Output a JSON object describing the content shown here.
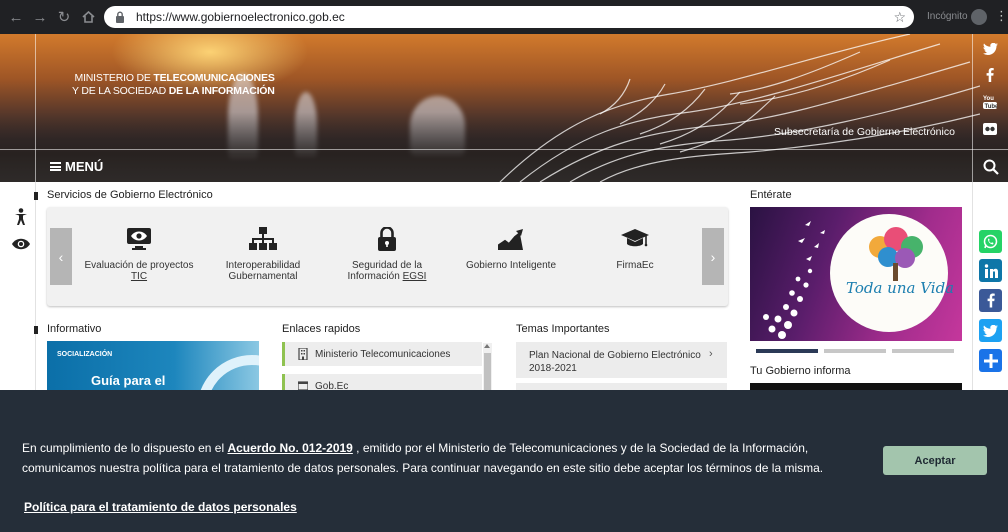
{
  "browser": {
    "url": "https://www.gobiernoelectronico.gob.ec",
    "incognito_label": "Incógnito"
  },
  "header": {
    "ministry_line1_a": "MINISTERIO DE ",
    "ministry_line1_b": "TELECOMUNICACIONES",
    "ministry_line2_a": "Y DE LA SOCIEDAD ",
    "ministry_line2_b": "DE LA INFORMACIÓN",
    "subsecretaria": "Subsecretaría de Gobierno Electrónico",
    "menu_label": "MENÚ"
  },
  "services": {
    "title": "Servicios de Gobierno Electrónico",
    "items": [
      {
        "label": "Evaluación de proyectos",
        "label2": "TIC",
        "icon": "monitor-eye-icon"
      },
      {
        "label": "Interoperabilidad",
        "label2": "Gubernamental",
        "icon": "hierarchy-icon"
      },
      {
        "label": "Seguridad de la",
        "label2a": "Información ",
        "label2b": "EGSI",
        "icon": "padlock-icon"
      },
      {
        "label": "Gobierno Inteligente",
        "icon": "growth-chart-icon"
      },
      {
        "label": "FirmaEc",
        "icon": "graduation-cap-icon"
      }
    ]
  },
  "enterate": {
    "title": "Entérate",
    "image_text": "Toda una Vida"
  },
  "tu_gobierno": {
    "title": "Tu Gobierno informa"
  },
  "informativo": {
    "title": "Informativo",
    "tag": "SOCIALIZACIÓN",
    "headline": "Guía para el"
  },
  "enlaces": {
    "title": "Enlaces rapidos",
    "items": [
      {
        "label": "Ministerio Telecomunicaciones"
      },
      {
        "label": "Gob.Ec"
      }
    ]
  },
  "temas": {
    "title": "Temas Importantes",
    "items": [
      {
        "label": "Plan Nacional de Gobierno Electrónico 2018-2021"
      }
    ]
  },
  "cookie": {
    "text_before": "En cumplimiento de lo dispuesto en el ",
    "link": "Acuerdo No. 012-2019",
    "text_after": " , emitido por el Ministerio de Telecomunicaciones y de la Sociedad de la Información, comunicamos nuestra política para el tratamiento de datos personales. Para continuar navegando en este sitio debe aceptar los términos de la misma.",
    "policy_link": "Política para el tratamiento de datos personales",
    "accept_label": "Aceptar"
  },
  "colors": {
    "cookie_bg": "#252e39",
    "accept_bg": "#a3c5ad",
    "whatsapp": "#25d366",
    "linkedin": "#0e76a8",
    "facebook": "#3b5998",
    "twitter": "#1da1f2",
    "share": "#1a73e8"
  }
}
